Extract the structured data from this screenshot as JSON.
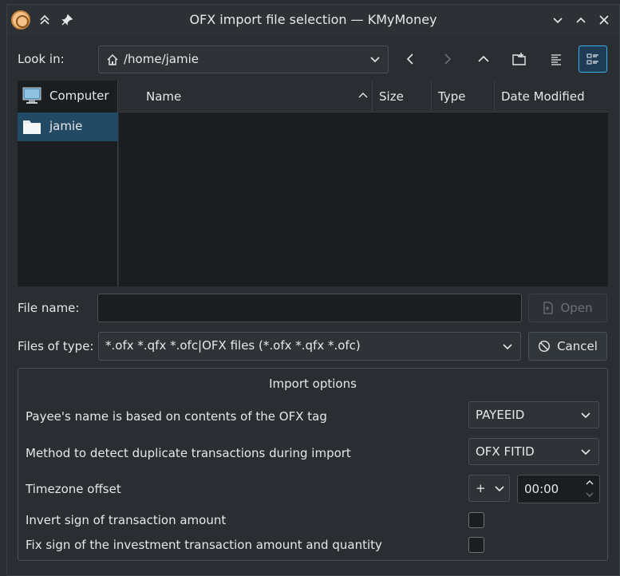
{
  "window": {
    "title": "OFX import file selection — KMyMoney",
    "titlebar_icons": [
      "kmymoney-app-icon",
      "keep-above-icon",
      "pin-icon",
      "minimize-icon",
      "maximize-icon",
      "close-icon"
    ]
  },
  "lookin": {
    "label": "Look in:",
    "path": "/home/jamie",
    "nav": [
      "back-icon",
      "forward-icon",
      "parent-folder-icon",
      "new-folder-icon",
      "list-view-icon",
      "detail-view-icon"
    ]
  },
  "places": [
    {
      "label": "Computer",
      "icon": "computer-icon",
      "selected": false
    },
    {
      "label": "jamie",
      "icon": "folder-icon",
      "selected": true
    }
  ],
  "files": {
    "columns": [
      "Name",
      "Size",
      "Type",
      "Date Modified"
    ],
    "rows": []
  },
  "filename": {
    "label": "File name:",
    "value": "",
    "open_label": "Open"
  },
  "filetype": {
    "label": "Files of type:",
    "value": "*.ofx *.qfx *.ofc|OFX files (*.ofx *.qfx *.ofc)",
    "cancel_label": "Cancel"
  },
  "import_options": {
    "title": "Import options",
    "payee_label": "Payee's name is based on contents of the OFX tag",
    "payee_value": "PAYEEID",
    "duplicate_label": "Method to detect duplicate transactions during import",
    "duplicate_value": "OFX FITID",
    "timezone_label": "Timezone offset",
    "timezone_sign": "+",
    "timezone_value": "00:00",
    "invert_label": "Invert sign of transaction amount",
    "invert_checked": false,
    "fixsign_label": "Fix sign of the investment transaction amount and quantity",
    "fixsign_checked": false
  },
  "colors": {
    "accent": "#3daee9",
    "selection": "#234a64",
    "background": "#2a2e32",
    "view_background": "#1b1e20"
  }
}
